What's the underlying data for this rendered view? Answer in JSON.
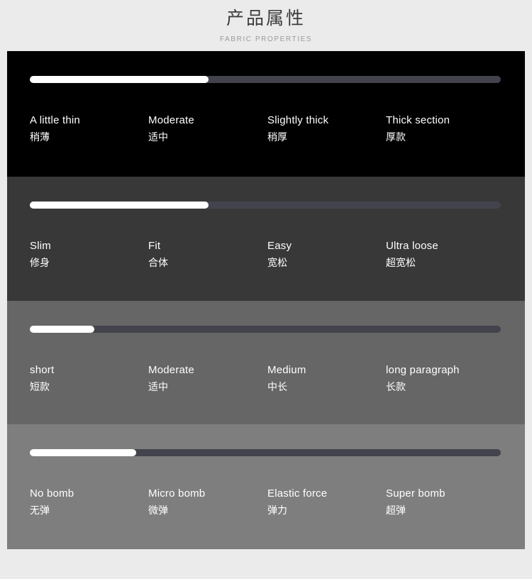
{
  "header": {
    "title": "产品属性",
    "subtitle": "FABRIC PROPERTIES"
  },
  "colors": {
    "page_background": "#ebebeb",
    "bar_fill": "#ffffff",
    "bar_track": "#43434e",
    "section_1_background": "#000000",
    "section_2_background": "#383838",
    "section_3_background": "#666666",
    "section_4_background": "#7e7e7e",
    "title_text": "#3c3c3c",
    "subtitle_text": "#9a9a9a",
    "label_text": "#ffffff"
  },
  "sections": [
    {
      "id": "thickness",
      "fill_percent": 38,
      "options": [
        {
          "en": "A little thin",
          "zh": "稍薄"
        },
        {
          "en": "Moderate",
          "zh": "适中"
        },
        {
          "en": "Slightly thick",
          "zh": "稍厚"
        },
        {
          "en": "Thick section",
          "zh": "厚款"
        }
      ]
    },
    {
      "id": "fit",
      "fill_percent": 38,
      "options": [
        {
          "en": "Slim",
          "zh": "修身"
        },
        {
          "en": "Fit",
          "zh": "合体"
        },
        {
          "en": "Easy",
          "zh": "宽松"
        },
        {
          "en": "Ultra loose",
          "zh": "超宽松"
        }
      ]
    },
    {
      "id": "length",
      "fill_percent": 13.7,
      "options": [
        {
          "en": "short",
          "zh": "短款"
        },
        {
          "en": "Moderate",
          "zh": "适中"
        },
        {
          "en": "Medium",
          "zh": "中长"
        },
        {
          "en": "long paragraph",
          "zh": "长款"
        }
      ]
    },
    {
      "id": "elasticity",
      "fill_percent": 22.6,
      "options": [
        {
          "en": "No bomb",
          "zh": "无弹"
        },
        {
          "en": "Micro bomb",
          "zh": "微弹"
        },
        {
          "en": "Elastic force",
          "zh": "弹力"
        },
        {
          "en": "Super bomb",
          "zh": "超弹"
        }
      ]
    }
  ]
}
